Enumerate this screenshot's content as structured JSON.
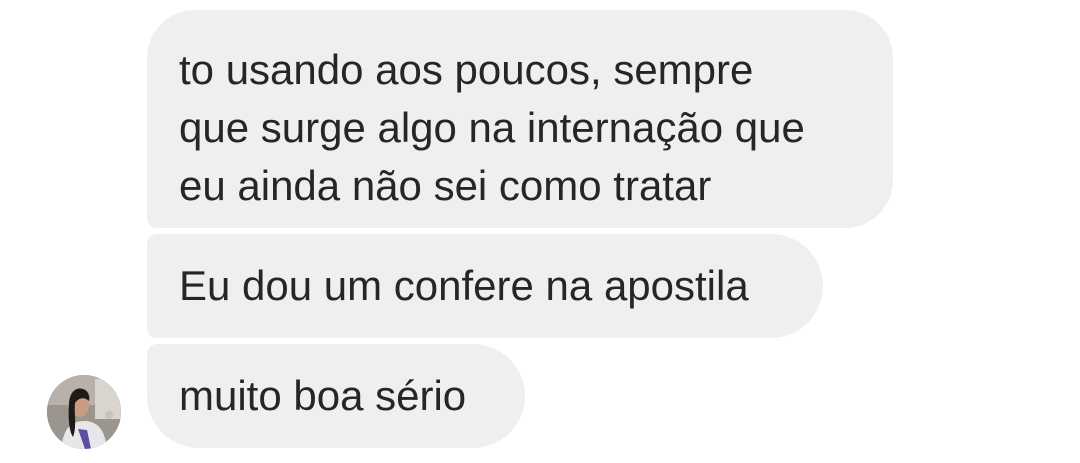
{
  "conversation": {
    "messages": [
      {
        "text": "to usando aos poucos, sempre\nque surge algo na internação que\neu ainda não sei como tratar"
      },
      {
        "text": "Eu dou um confere na apostila"
      },
      {
        "text": "muito boa sério"
      }
    ],
    "sender_avatar": {
      "icon": "profile-photo-avatar"
    }
  },
  "colors": {
    "bubble_background": "#efefef",
    "text": "#262626",
    "page_background": "#ffffff"
  }
}
